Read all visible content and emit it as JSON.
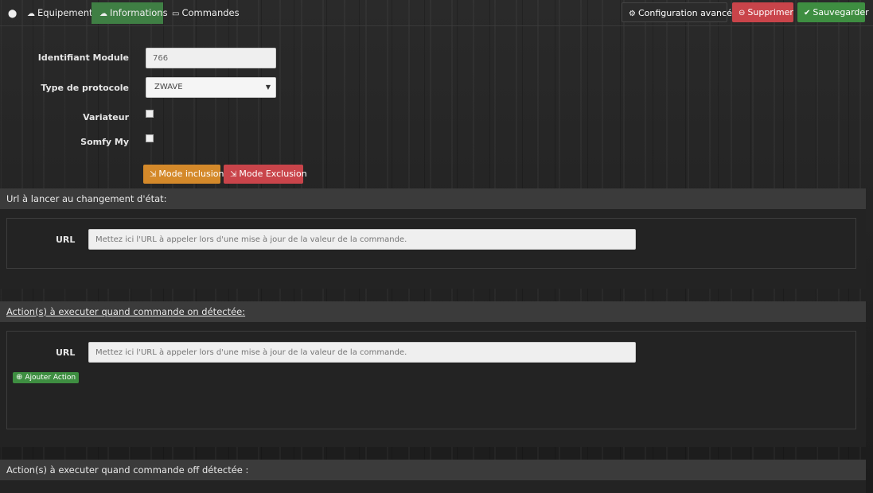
{
  "topbar": {
    "tabs": [
      {
        "label": "",
        "icon": "circle-arrow-icon"
      },
      {
        "label": "Equipement",
        "icon": "tachometer-icon"
      },
      {
        "label": "Informations",
        "icon": "tachometer-icon",
        "active": true
      },
      {
        "label": "Commandes",
        "icon": "list-icon"
      }
    ],
    "buttons": {
      "config_label": "Configuration avancée",
      "delete_label": "Supprimer",
      "save_label": "Sauvegarder"
    }
  },
  "form": {
    "module_id_label": "Identifiant Module",
    "module_id_value": "766",
    "protocol_label": "Type de protocole",
    "protocol_value": "ZWAVE",
    "variateur_label": "Variateur",
    "somfy_label": "Somfy My",
    "inclusion_label": "Mode inclusion",
    "exclusion_label": "Mode Exclusion"
  },
  "sections": {
    "url_change": {
      "title": "Url à lancer au changement d'état:",
      "url_label": "URL",
      "url_placeholder": "Mettez ici l'URL à appeler lors d'une mise à jour de la valeur de la commande."
    },
    "actions_on": {
      "title": "Action(s) à executer quand commande on détectée:",
      "url_label": "URL",
      "url_placeholder": "Mettez ici l'URL à appeler lors d'une mise à jour de la valeur de la commande.",
      "add_action_label": "Ajouter Action"
    },
    "actions_off": {
      "title": "Action(s) à executer quand commande off détectée :"
    }
  },
  "colors": {
    "success": "#3e8e41",
    "danger": "#c9444a",
    "warning": "#d4892a",
    "active_tab": "#3f7f44"
  }
}
